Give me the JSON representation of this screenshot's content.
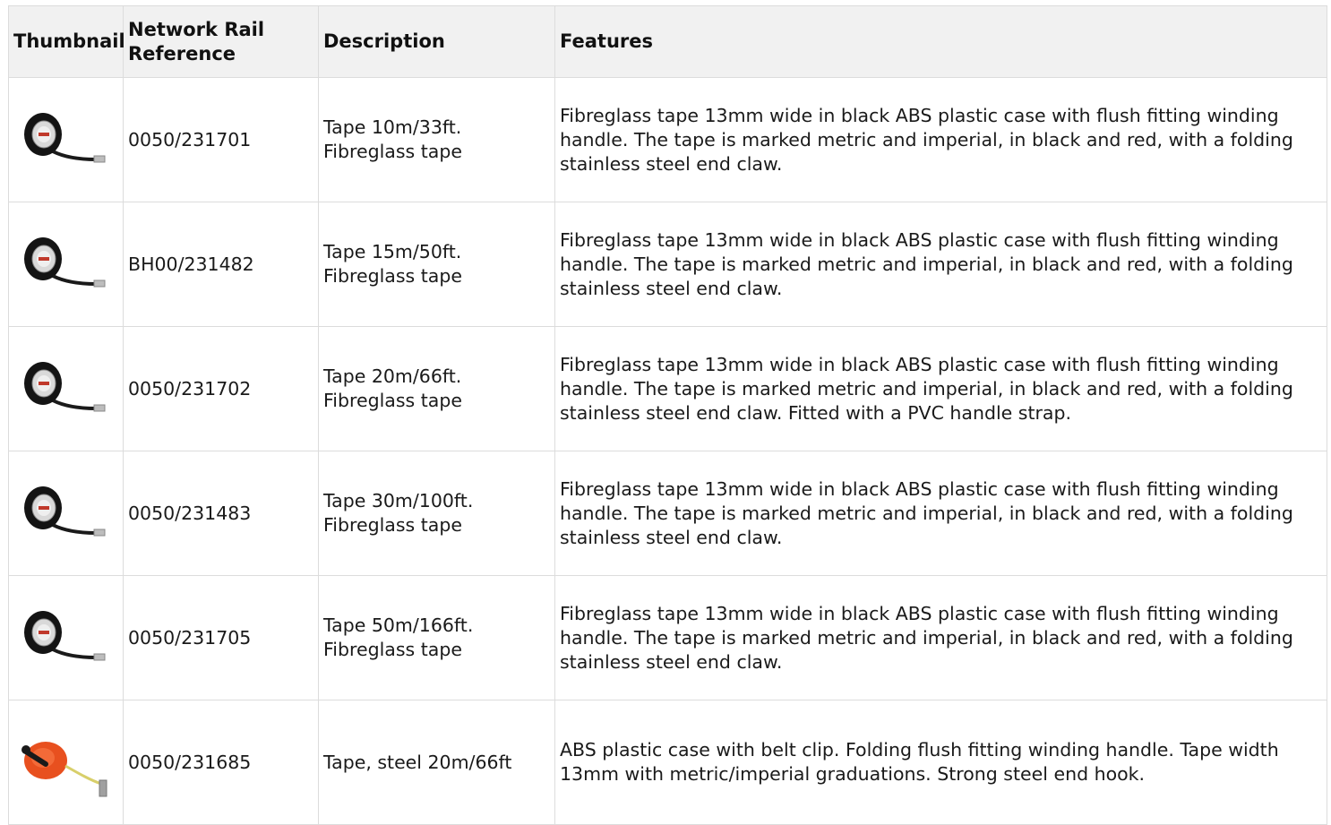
{
  "table": {
    "headers": {
      "thumbnail": "Thumbnail",
      "reference": "Network Rail Reference",
      "description": "Description",
      "features": "Features"
    },
    "rows": [
      {
        "thumbnail": "fibreglass-tape-measure-icon",
        "reference": "0050/231701",
        "description": "Tape 10m/33ft. Fibreglass tape",
        "features": "Fibreglass tape 13mm wide in black ABS plastic case with flush fitting winding handle. The tape is marked metric and imperial, in black and red, with a folding stainless steel end claw."
      },
      {
        "thumbnail": "fibreglass-tape-measure-icon",
        "reference": "BH00/231482",
        "description": "Tape 15m/50ft. Fibreglass tape",
        "features": "Fibreglass tape 13mm wide in black ABS plastic case with flush fitting winding handle. The tape is marked metric and imperial, in black and red, with a folding stainless steel end claw."
      },
      {
        "thumbnail": "fibreglass-tape-measure-icon",
        "reference": "0050/231702",
        "description": "Tape 20m/66ft. Fibreglass tape",
        "features": "Fibreglass tape 13mm wide in black ABS plastic case with flush fitting winding handle. The tape is marked metric and imperial, in black and red, with a folding stainless steel end claw. Fitted with a PVC handle strap."
      },
      {
        "thumbnail": "fibreglass-tape-measure-icon",
        "reference": "0050/231483",
        "description": "Tape 30m/100ft. Fibreglass tape",
        "features": "Fibreglass tape 13mm wide in black ABS plastic case with flush fitting winding handle. The tape is marked metric and imperial, in black and red, with a folding stainless steel end claw."
      },
      {
        "thumbnail": "fibreglass-tape-measure-icon",
        "reference": "0050/231705",
        "description": "Tape 50m/166ft. Fibreglass tape",
        "features": "Fibreglass tape 13mm wide in black ABS plastic case with flush fitting winding handle. The tape is marked metric and imperial, in black and red, with a folding stainless steel end claw."
      },
      {
        "thumbnail": "steel-tape-measure-icon",
        "reference": "0050/231685",
        "description": "Tape, steel 20m/66ft",
        "features": "ABS plastic case with belt clip. Folding flush fitting winding handle. Tape width 13mm with metric/imperial graduations. Strong steel end hook."
      }
    ]
  }
}
